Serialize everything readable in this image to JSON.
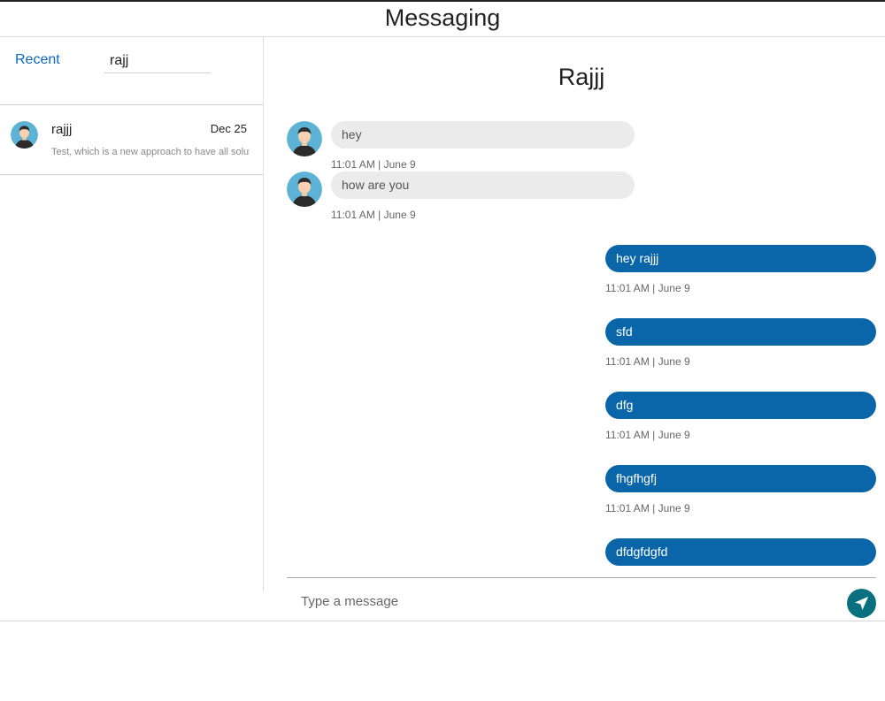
{
  "header": {
    "title": "Messaging"
  },
  "sidebar": {
    "recent_label": "Recent",
    "search": {
      "value": "rajj",
      "placeholder": ""
    },
    "conversations": [
      {
        "name": "rajjj",
        "date": "Dec 25",
        "preview": "Test, which is a new approach to have all solutions"
      }
    ]
  },
  "chat": {
    "title": "Rajjj",
    "incoming": [
      {
        "text": "hey",
        "time": "11:01 AM | June 9"
      },
      {
        "text": "how are you",
        "time": "11:01 AM | June 9"
      }
    ],
    "outgoing": [
      {
        "text": "hey rajjj",
        "time": "11:01 AM | June 9"
      },
      {
        "text": "sfd",
        "time": "11:01 AM | June 9"
      },
      {
        "text": "dfg",
        "time": "11:01 AM | June 9"
      },
      {
        "text": "fhgfhgfj",
        "time": "11:01 AM | June 9"
      },
      {
        "text": "dfdgfdgfd",
        "time": ""
      }
    ],
    "compose": {
      "placeholder": "Type a message",
      "send_icon": "send-icon"
    }
  },
  "colors": {
    "accent": "#0a66c2",
    "outgoing_bubble": "#0a66a8",
    "incoming_bubble": "#ebebeb",
    "send_button": "#0a7080"
  }
}
